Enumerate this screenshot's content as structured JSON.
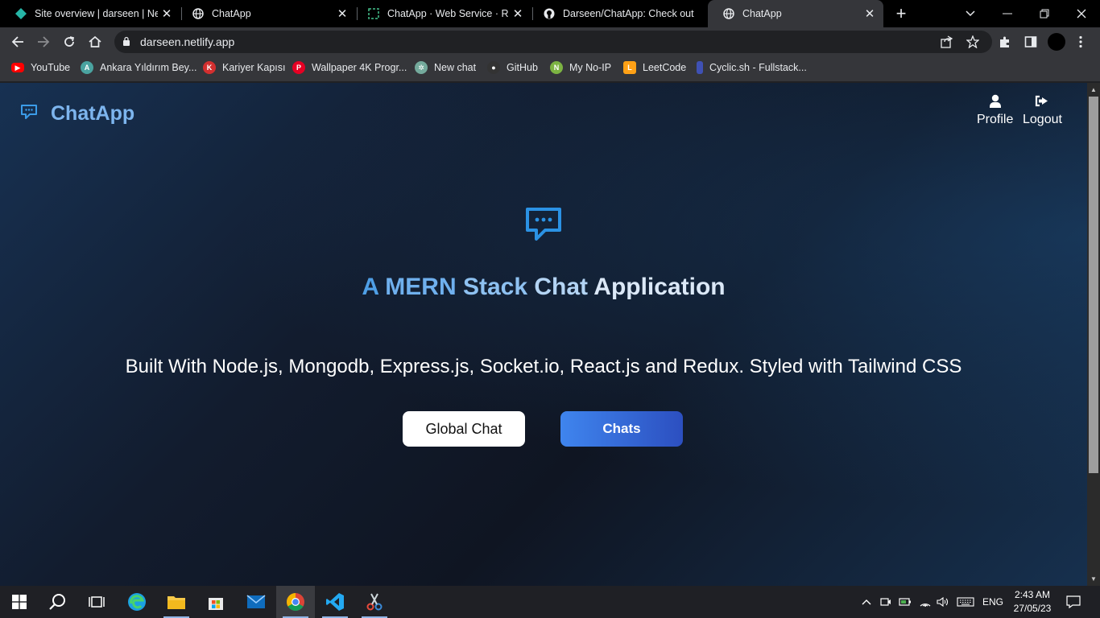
{
  "browser": {
    "tabs": [
      {
        "title": "Site overview | darseen | Netlify",
        "favicon": "netlify-icon"
      },
      {
        "title": "ChatApp",
        "favicon": "globe-icon"
      },
      {
        "title": "ChatApp · Web Service · Render",
        "favicon": "render-icon"
      },
      {
        "title": "Darseen/ChatApp: Check out",
        "favicon": "github-icon"
      },
      {
        "title": "ChatApp",
        "favicon": "globe-icon",
        "active": true
      }
    ],
    "url": "darseen.netlify.app",
    "bookmarks": [
      {
        "label": "YouTube",
        "color": "#ff0000"
      },
      {
        "label": "Ankara Yıldırım Bey...",
        "color": "#4aa3a0"
      },
      {
        "label": "Kariyer Kapısı",
        "color": "#d32f2f"
      },
      {
        "label": "Wallpaper 4K Progr...",
        "color": "#e60023"
      },
      {
        "label": "New chat",
        "color": "#74aa9c"
      },
      {
        "label": "GitHub",
        "color": "#333333"
      },
      {
        "label": "My No-IP",
        "color": "#7cb342"
      },
      {
        "label": "LeetCode",
        "color": "#ffa116"
      },
      {
        "label": "Cyclic.sh - Fullstack...",
        "color": "#3f51b5"
      }
    ]
  },
  "app": {
    "brand": "ChatApp",
    "nav": {
      "profile": "Profile",
      "logout": "Logout"
    },
    "headline": {
      "w1": "A",
      "w2": "MERN",
      "w3": "Stack",
      "w4": "Chat",
      "w5": "Application"
    },
    "tagline": "Built With Node.js, Mongodb, Express.js, Socket.io, React.js and Redux. Styled with Tailwind CSS",
    "buttons": {
      "global_chat": "Global Chat",
      "chats": "Chats"
    },
    "accent": "#3b9ce8"
  },
  "taskbar": {
    "apps": [
      "start-icon",
      "search-icon",
      "task-view-icon",
      "edge-icon",
      "file-explorer-icon",
      "store-icon",
      "mail-icon",
      "chrome-icon",
      "vscode-icon",
      "snipping-tool-icon"
    ],
    "language": "ENG",
    "time": "2:43 AM",
    "date": "27/05/23"
  }
}
